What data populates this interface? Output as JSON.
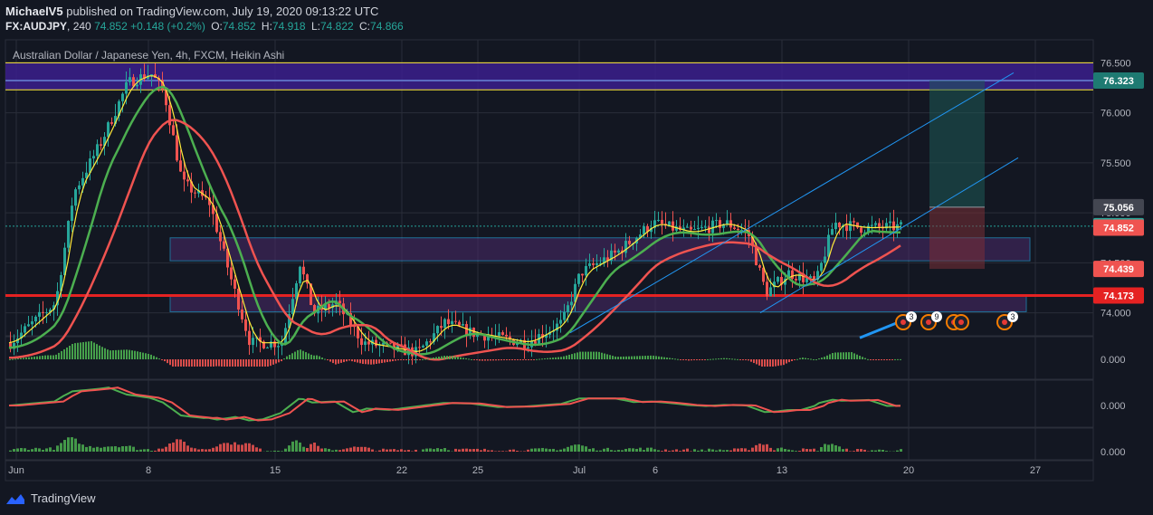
{
  "header": {
    "author": "MichaelV5",
    "published_text": "published on TradingView.com, July 19, 2020 09:13:22 UTC",
    "symbol": "FX:AUDJPY",
    "interval": "240",
    "last_price": "74.852",
    "change": "+0.148 (+0.2%)",
    "open_label": "O:",
    "open": "74.852",
    "high_label": "H:",
    "high": "74.918",
    "low_label": "L:",
    "low": "74.822",
    "close_label": "C:",
    "close": "74.866"
  },
  "chart_title": "Australian Dollar / Japanese Yen, 4h, FXCM, Heikin Ashi",
  "footer": {
    "brand": "TradingView"
  },
  "colors": {
    "bg": "#131722",
    "up": "#26a69a",
    "down": "#ef5350",
    "grid": "#2a2e39",
    "zone_fill": "#4a2a6a",
    "zone_border": "#29b6f6",
    "sma_fast": "#ffeb3b",
    "ema_green": "#4caf50",
    "ema_red": "#ef5350",
    "support_line": "#e52222",
    "channel": "#2196f3",
    "resistance_yellow": "#ffeb3b"
  },
  "chart_data": {
    "type": "candlestick",
    "x_ticks": [
      "Jun",
      "8",
      "15",
      "22",
      "25",
      "Jul",
      "6",
      "13",
      "20",
      "27"
    ],
    "y_ticks": [
      "76.500",
      "76.000",
      "75.500",
      "75.000",
      "74.500",
      "74.000"
    ],
    "ylim": [
      73.77,
      76.73
    ],
    "price_labels": [
      {
        "text": "76.323",
        "value": 76.323,
        "color": "#1e7a72"
      },
      {
        "text": "75.056",
        "value": 75.056,
        "color": "#434651"
      },
      {
        "text": "74.866",
        "value": 74.866,
        "color": "#26a69a"
      },
      {
        "text": "74.852",
        "value": 74.852,
        "color": "#ef5350"
      },
      {
        "text": "74.439",
        "value": 74.439,
        "color": "#ef5350"
      },
      {
        "text": "74.173",
        "value": 74.173,
        "color": "#e52222"
      }
    ],
    "levels": {
      "resistance_top": 76.5,
      "resistance_bottom": 76.23,
      "support_line": 74.173,
      "upper_zone": [
        74.52,
        74.75
      ],
      "lower_zone": [
        74.01,
        74.17
      ]
    },
    "indicator_panes": [
      {
        "name": "pane1",
        "tick": "0.000"
      },
      {
        "name": "pane2",
        "tick": "0.000"
      },
      {
        "name": "pane3",
        "tick": "0.000"
      }
    ],
    "event_badges": [
      "3",
      "9",
      "3"
    ]
  }
}
